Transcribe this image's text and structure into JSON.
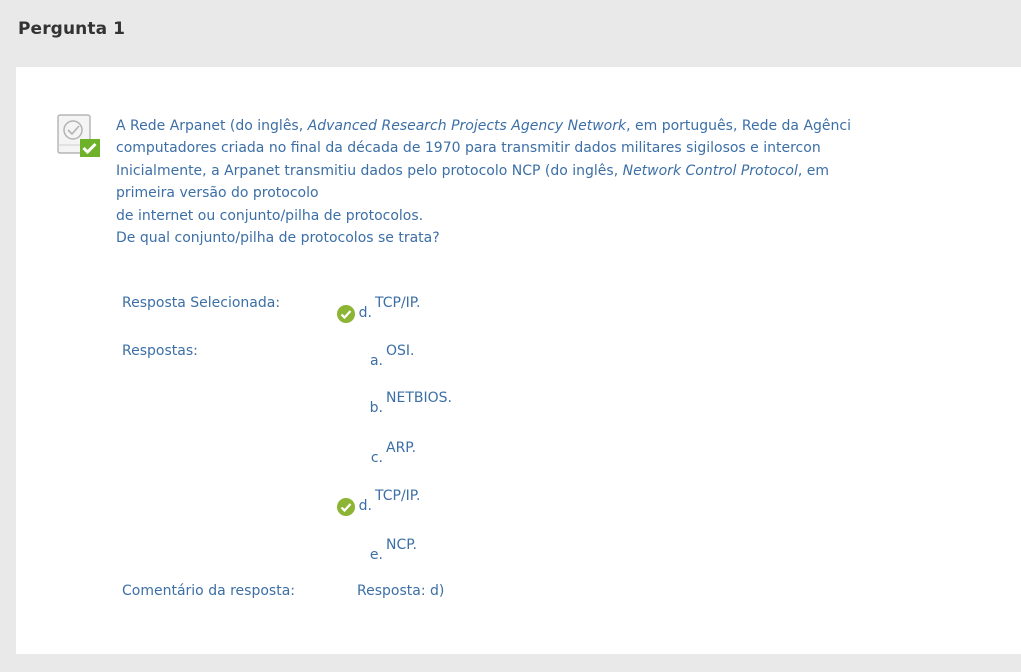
{
  "question": {
    "title": "Pergunta 1",
    "text_lines": [
      [
        "A Rede Arpanet (do inglês, ",
        "Advanced Research Projects Agency Network",
        ", em português, Rede da Agênci"
      ],
      [
        "computadores criada no final da década de 1970 para transmitir dados militares sigilosos e intercon"
      ],
      [
        "Inicialmente, a Arpanet transmitiu dados pelo protocolo NCP (do inglês, ",
        "Network Control Protocol",
        ", em"
      ],
      [
        "primeira versão do protocolo"
      ],
      [
        "de internet ou conjunto/pilha de protocolos."
      ],
      [
        "De qual conjunto/pilha de protocolos se trata?"
      ]
    ]
  },
  "labels": {
    "selected": "Resposta Selecionada:",
    "answers": "Respostas:",
    "comment": "Comentário da resposta:"
  },
  "selected_answer": {
    "letter": "d.",
    "text": "TCP/IP."
  },
  "answers": [
    {
      "letter": "a.",
      "text": "OSI.",
      "correct": false
    },
    {
      "letter": "b.",
      "text": "NETBIOS.",
      "correct": false
    },
    {
      "letter": "c.",
      "text": "ARP.",
      "correct": false
    },
    {
      "letter": "d.",
      "text": "TCP/IP.",
      "correct": true
    },
    {
      "letter": "e.",
      "text": "NCP.",
      "correct": false
    }
  ],
  "comment": "Resposta: d)",
  "colors": {
    "text": "#3c6fa6",
    "check": "#8cb535",
    "header": "#333333"
  }
}
